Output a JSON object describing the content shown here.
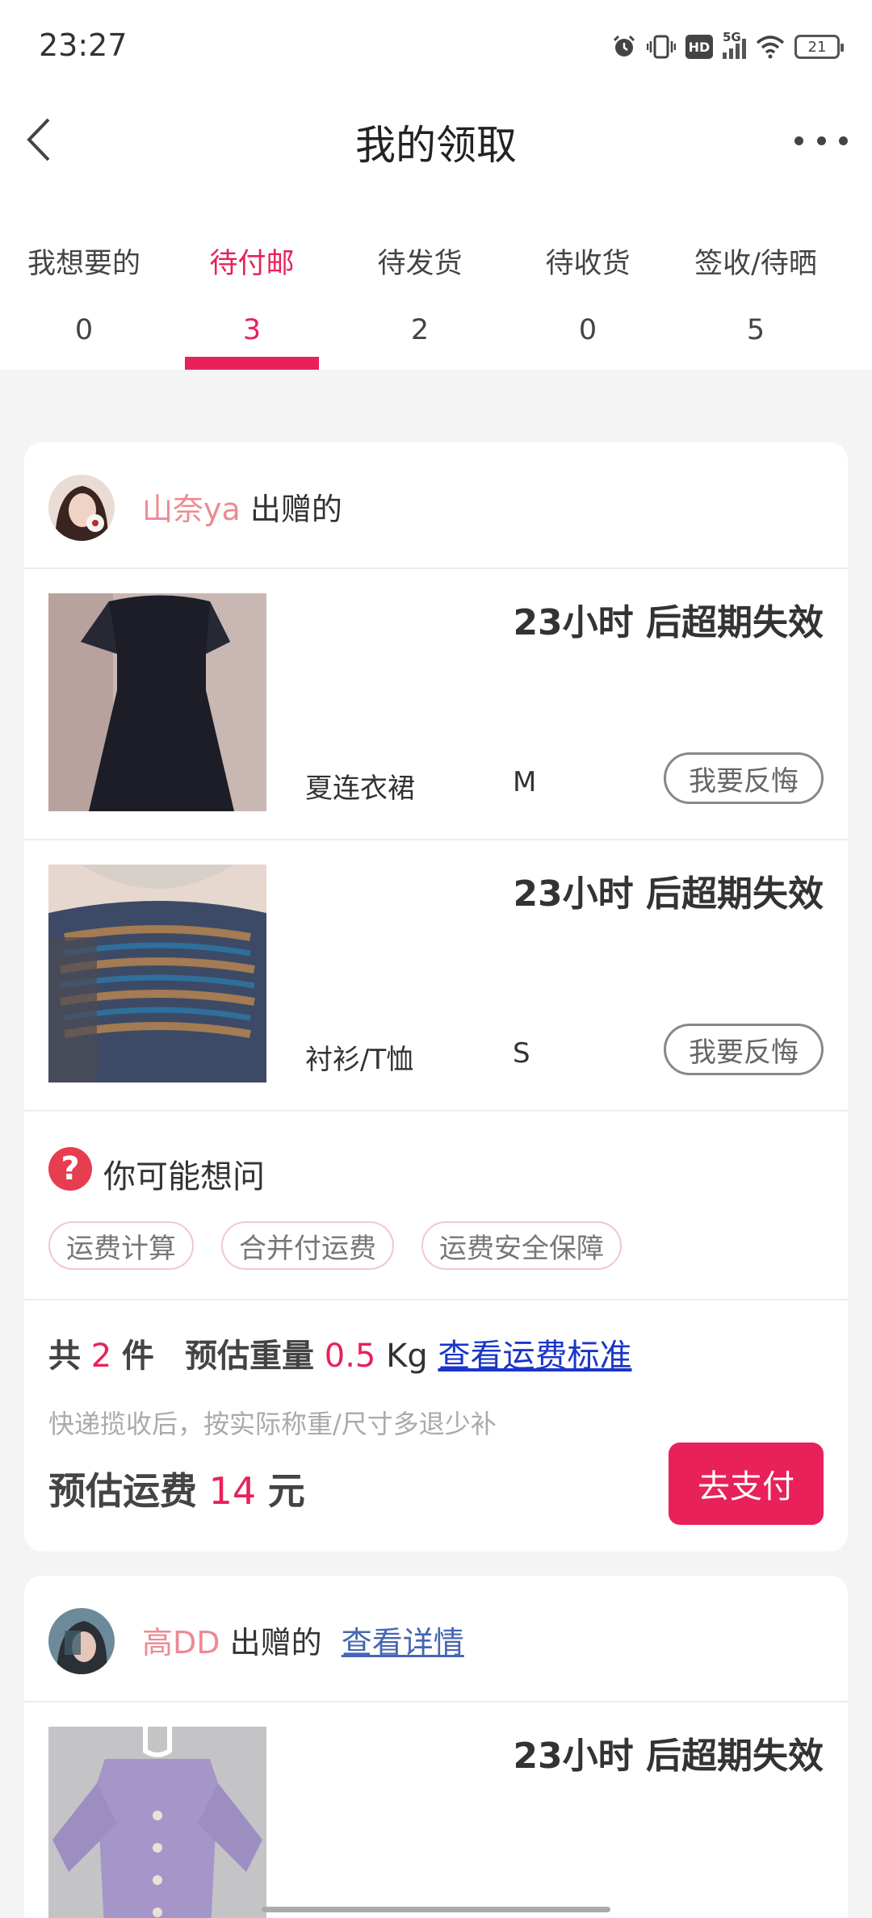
{
  "status_bar": {
    "time": "23:27",
    "network": "5G",
    "hd": "HD",
    "battery": "21",
    "icons": [
      "alarm-icon",
      "vibrate-icon",
      "hd-icon",
      "signal-icon",
      "wifi-icon",
      "battery-icon"
    ]
  },
  "header": {
    "title": "我的领取",
    "back_icon": "chevron-left-icon",
    "more_icon": "more-horizontal-icon"
  },
  "tabs": [
    {
      "label": "我想要的",
      "count": "0",
      "active": false
    },
    {
      "label": "待付邮",
      "count": "3",
      "active": true
    },
    {
      "label": "待发货",
      "count": "2",
      "active": false
    },
    {
      "label": "待收货",
      "count": "0",
      "active": false
    },
    {
      "label": "签收/待晒",
      "count": "5",
      "active": false
    }
  ],
  "colors": {
    "accent": "#e8215a",
    "donor_name": "#eb8a93",
    "link": "#1a35c8",
    "background": "#f4f4f4"
  },
  "orders": [
    {
      "donor_name": "山奈ya",
      "donor_suffix": "出赠的",
      "items": [
        {
          "expire": "23小时 后超期失效",
          "name": "夏连衣裙",
          "size": "M",
          "regret_label": "我要反悔"
        },
        {
          "expire": "23小时 后超期失效",
          "name": "衬衫/T恤",
          "size": "S",
          "regret_label": "我要反悔"
        }
      ],
      "faq": {
        "title": "你可能想问",
        "chips": [
          "运费计算",
          "合并付运费",
          "运费安全保障"
        ]
      },
      "summary": {
        "total_prefix": "共",
        "total_count": "2",
        "total_suffix": "件",
        "weight_label": "预估重量",
        "weight_value": "0.5",
        "weight_unit": "Kg",
        "standard_link": "查看运费标准",
        "note": "快递揽收后，按实际称重/尺寸多退少补",
        "fee_label": "预估运费",
        "fee_value": "14",
        "fee_unit": "元",
        "pay_button": "去支付"
      }
    },
    {
      "donor_name": "高DD",
      "donor_suffix": "出赠的",
      "detail_link": "查看详情",
      "items": [
        {
          "expire": "23小时 后超期失效"
        }
      ]
    }
  ]
}
